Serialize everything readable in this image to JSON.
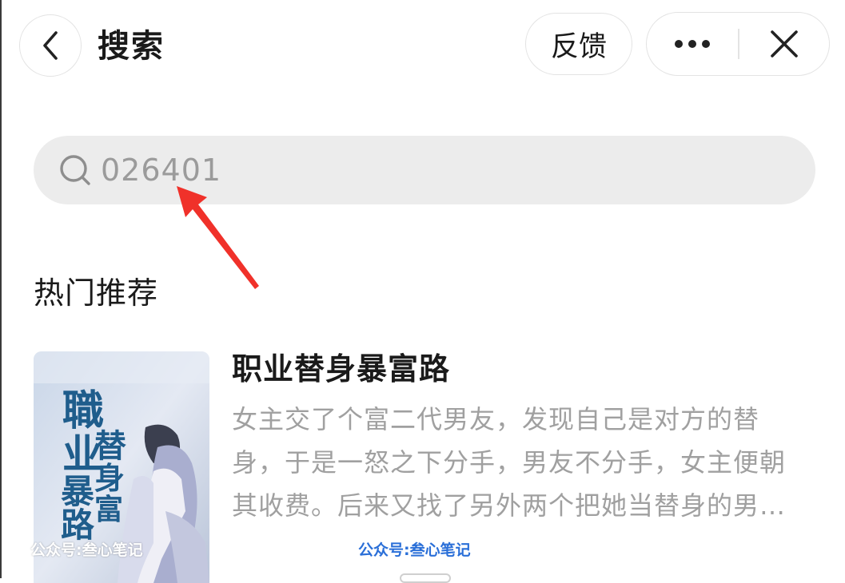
{
  "header": {
    "title": "搜索",
    "feedback_label": "反馈",
    "icons": {
      "back": "chevron-left-icon",
      "more": "more-dots-icon",
      "close": "close-icon"
    }
  },
  "search": {
    "value": "026401",
    "icon": "search-icon"
  },
  "section": {
    "title": "热门推荐"
  },
  "book": {
    "title": "职业替身暴富路",
    "description": "女主交了个富二代男友，发现自己是对方的替身，于是一怒之下分手，男友不分手，女主便朝其收费。后来又找了另外两个把她当替身的男人…",
    "cover_title": "职业替身暴富路"
  },
  "watermark": {
    "text": "公众号:叁心笔记"
  },
  "colors": {
    "text_primary": "#1a1a1a",
    "text_secondary": "#a0a0a0",
    "search_bg": "#ececec",
    "border": "#e3e3e3",
    "annotation_red": "#f0312a"
  }
}
